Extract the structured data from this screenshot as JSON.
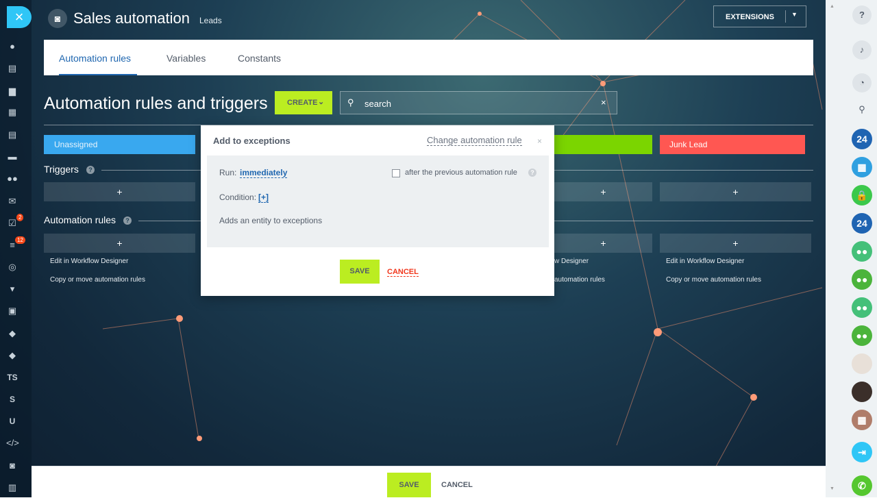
{
  "header": {
    "title": "Sales automation",
    "subtitle": "Leads",
    "extensions_label": "EXTENSIONS"
  },
  "tabs": [
    {
      "label": "Automation rules",
      "active": true
    },
    {
      "label": "Variables",
      "active": false
    },
    {
      "label": "Constants",
      "active": false
    }
  ],
  "toolbar": {
    "page_title": "Automation rules and triggers",
    "create_label": "CREATE",
    "search_value": "search"
  },
  "stages": {
    "first": "Unassigned",
    "last": "Junk Lead"
  },
  "sections": {
    "triggers": "Triggers",
    "automation_rules": "Automation rules",
    "help_glyph": "?",
    "plus": "+"
  },
  "rule_links": {
    "edit": "Edit in Workflow Designer",
    "edit_partial": "w Designer",
    "copy": "Copy or move automation rules",
    "copy_partial": "automation rules"
  },
  "left_menu": {
    "badges": [
      "2",
      "12"
    ],
    "text_items": [
      "TS",
      "S",
      "U"
    ]
  },
  "right_bar": {
    "av_24": "24",
    "help_glyph": "?"
  },
  "bottom": {
    "save_label": "SAVE",
    "cancel_label": "CANCEL"
  },
  "modal": {
    "title": "Add to exceptions",
    "change_link": "Change automation rule",
    "close_glyph": "×",
    "run_label": "Run:",
    "run_value": "immediately",
    "checkbox_label": "after the previous automation rule",
    "condition_label": "Condition:",
    "condition_add": "[+]",
    "description": "Adds an entity to exceptions",
    "save_label": "SAVE",
    "cancel_label": "CANCEL"
  },
  "colors": {
    "accent_blue": "#2067b0",
    "button_green": "#bbed21",
    "stage_blue": "#39a8ef",
    "stage_green": "#7bd500",
    "stage_red": "#ff5752",
    "cancel_red": "#f1361b"
  }
}
